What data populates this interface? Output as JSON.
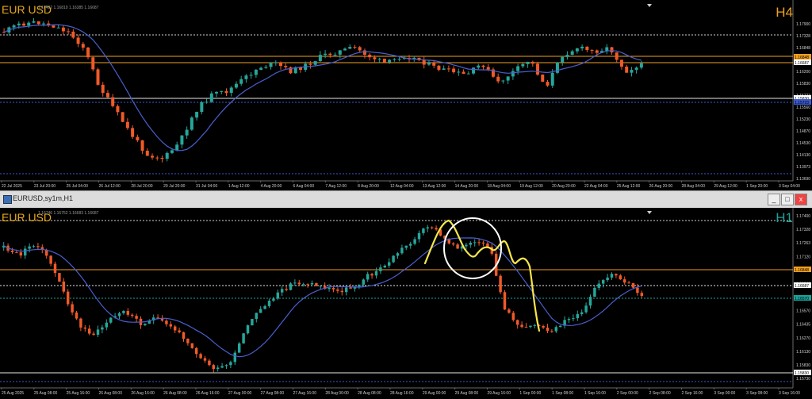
{
  "top": {
    "symbol": "EUR USD",
    "ohlc": "1.16482 1.16819 1.16385 1.16687",
    "timeframe": "H4",
    "timeframe_color": "#f0a020",
    "price_ticks": [
      "1.17900",
      "1.17328",
      "1.16848",
      "1.16687",
      "1.16200",
      "1.15830",
      "1.15723",
      "1.15560",
      "1.15230",
      "1.14870",
      "1.14530",
      "1.14130",
      "1.13973",
      "1.13690"
    ],
    "time_ticks": [
      "22 Jul 2025",
      "23 Jul 20:00",
      "25 Jul 04:00",
      "26 Jul 12:00",
      "28 Jul 20:00",
      "29 Jul 20:00",
      "31 Jul 04:00",
      "1 Aug 12:00",
      "4 Aug 20:00",
      "6 Aug 04:00",
      "7 Aug 12:00",
      "8 Aug 20:00",
      "12 Aug 04:00",
      "13 Aug 12:00",
      "14 Aug 20:00",
      "18 Aug 04:00",
      "19 Aug 12:00",
      "20 Aug 20:00",
      "22 Aug 04:00",
      "25 Aug 12:00",
      "26 Aug 20:00",
      "28 Aug 04:00",
      "29 Aug 12:00",
      "1 Sep 20:00",
      "3 Sep 04:00"
    ]
  },
  "window": {
    "title": "EURUSD,sy1m,H1",
    "btn_min": "_",
    "btn_max": "□",
    "btn_close": "x"
  },
  "bottom": {
    "symbol": "EUR USD",
    "ohlc": "1.16746 1.16752 1.16683 1.16687",
    "timeframe": "H1",
    "timeframe_color": "#1aa39a",
    "price_ticks": [
      "1.17400",
      "1.17328",
      "1.17263",
      "1.17120",
      "1.16980",
      "1.16848",
      "1.16687",
      "1.16570",
      "1.16435",
      "1.16270",
      "1.16130",
      "1.15830",
      "1.15730"
    ],
    "time_ticks": [
      "25 Aug 2025",
      "25 Aug 08:00",
      "25 Aug 16:00",
      "26 Aug 08:00",
      "26 Aug 16:00",
      "26 Aug 08:00",
      "26 Aug 16:00",
      "27 Aug 00:00",
      "27 Aug 08:00",
      "27 Aug 16:00",
      "28 Aug 00:00",
      "28 Aug 08:00",
      "28 Aug 16:00",
      "29 Aug 00:00",
      "29 Aug 08:00",
      "29 Aug 16:00",
      "1 Sep 00:00",
      "1 Sep 08:00",
      "1 Sep 16:00",
      "2 Sep 00:00",
      "2 Sep 08:00",
      "2 Sep 16:00",
      "3 Sep 00:00",
      "3 Sep 08:00",
      "3 Sep 16:00"
    ]
  },
  "colors": {
    "bull": "#26a69a",
    "bear": "#f05a28",
    "ma": "#4a5fd0",
    "level_orange": "#f0a020",
    "highlight_yellow": "#f5e64a",
    "circle": "#ffffff"
  }
}
